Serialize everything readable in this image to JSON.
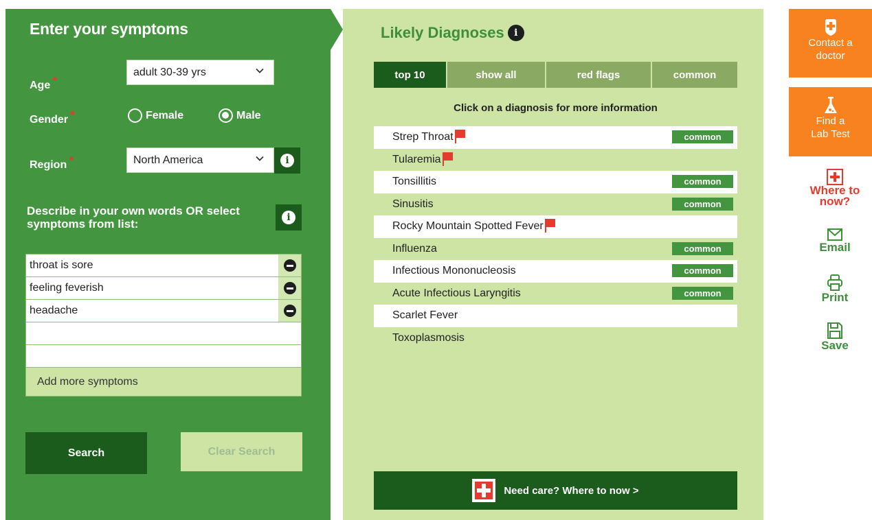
{
  "left": {
    "title": "Enter your symptoms",
    "age_label": "Age",
    "age_value": "adult 30-39 yrs",
    "gender_label": "Gender",
    "gender_options": [
      "Female",
      "Male"
    ],
    "gender_selected": "Male",
    "region_label": "Region",
    "region_value": "North America",
    "required_mark": "*",
    "describe_text": "Describe in your own words OR select symptoms from list:",
    "symptoms": [
      "throat is sore",
      "feeling feverish",
      "headache",
      "",
      ""
    ],
    "add_more": "Add more symptoms",
    "search_label": "Search",
    "clear_label": "Clear Search"
  },
  "diagnoses": {
    "title": "Likely Diagnoses",
    "tabs": [
      {
        "label": "top 10",
        "active": true
      },
      {
        "label": "show all",
        "active": false
      },
      {
        "label": "red flags",
        "active": false
      },
      {
        "label": "common",
        "active": false
      }
    ],
    "hint": "Click on a diagnosis for more information",
    "items": [
      {
        "name": "Strep Throat",
        "red_flag": true,
        "common": true
      },
      {
        "name": "Tularemia",
        "red_flag": true,
        "common": false
      },
      {
        "name": "Tonsillitis",
        "red_flag": false,
        "common": true
      },
      {
        "name": "Sinusitis",
        "red_flag": false,
        "common": true
      },
      {
        "name": "Rocky Mountain Spotted Fever",
        "red_flag": true,
        "common": false
      },
      {
        "name": "Influenza",
        "red_flag": false,
        "common": true
      },
      {
        "name": "Infectious Mononucleosis",
        "red_flag": false,
        "common": true
      },
      {
        "name": "Acute Infectious Laryngitis",
        "red_flag": false,
        "common": true
      },
      {
        "name": "Scarlet Fever",
        "red_flag": false,
        "common": false
      },
      {
        "name": "Toxoplasmosis",
        "red_flag": false,
        "common": false
      }
    ],
    "common_badge": "common",
    "care_text": "Need care?  Where to now >"
  },
  "sidebar": {
    "contact_line1": "Contact a",
    "contact_line2": "doctor",
    "lab_line1": "Find a",
    "lab_line2": "Lab Test",
    "where_line1": "Where to",
    "where_line2": "now?",
    "email": "Email",
    "print": "Print",
    "save": "Save"
  },
  "colors": {
    "panel_green": "#43963f",
    "dark_green": "#1b5c1d",
    "light_green": "#cde4a5",
    "tab_olive": "#8aa962",
    "orange": "#f7821f",
    "red": "#e53a2e"
  }
}
